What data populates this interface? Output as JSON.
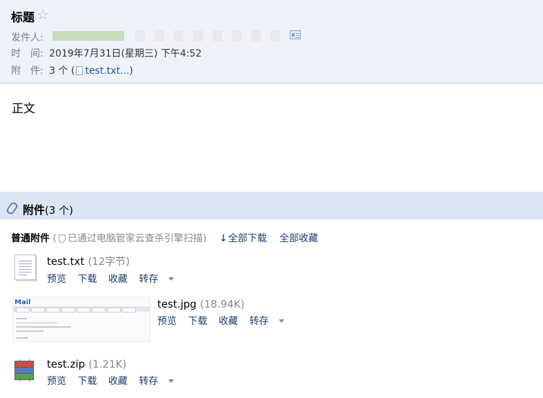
{
  "header": {
    "subject": "标题",
    "star_icon": "star-outline-icon",
    "sender_label": "发件人:",
    "time_label": "时　间:",
    "time_value": "2019年7月31日(星期三) 下午4:52",
    "attach_label": "附　件:",
    "attach_count": "3 个",
    "attach_open": "(",
    "attach_first": "test.txt...",
    "attach_close": ")"
  },
  "body": {
    "text": "正文"
  },
  "attachments": {
    "title": "附件",
    "count": "(3 个)",
    "normal_label": "普通附件",
    "scan_note_open": "(",
    "scan_note": "已通过电脑管家云查杀引擎扫描",
    "scan_note_close": ")",
    "download_all": "全部下载",
    "collect_all": "全部收藏",
    "files": [
      {
        "name": "test.txt",
        "size": "(12字节)",
        "preview": "预览",
        "download": "下载",
        "collect": "收藏",
        "save": "转存",
        "icon": "text-file-icon"
      },
      {
        "name": "test.jpg",
        "size": "(18.94K)",
        "preview": "预览",
        "download": "下载",
        "collect": "收藏",
        "save": "转存",
        "icon": "image-thumbnail"
      },
      {
        "name": "test.zip",
        "size": "(1.21K)",
        "preview": "预览",
        "download": "下载",
        "collect": "收藏",
        "save": "转存",
        "icon": "zip-archive-icon"
      }
    ],
    "thumb_logo": "Mail"
  },
  "colors": {
    "header_bg": "#eef3fb",
    "attach_bar_bg": "#dbe6f4",
    "link": "#1e5494"
  }
}
